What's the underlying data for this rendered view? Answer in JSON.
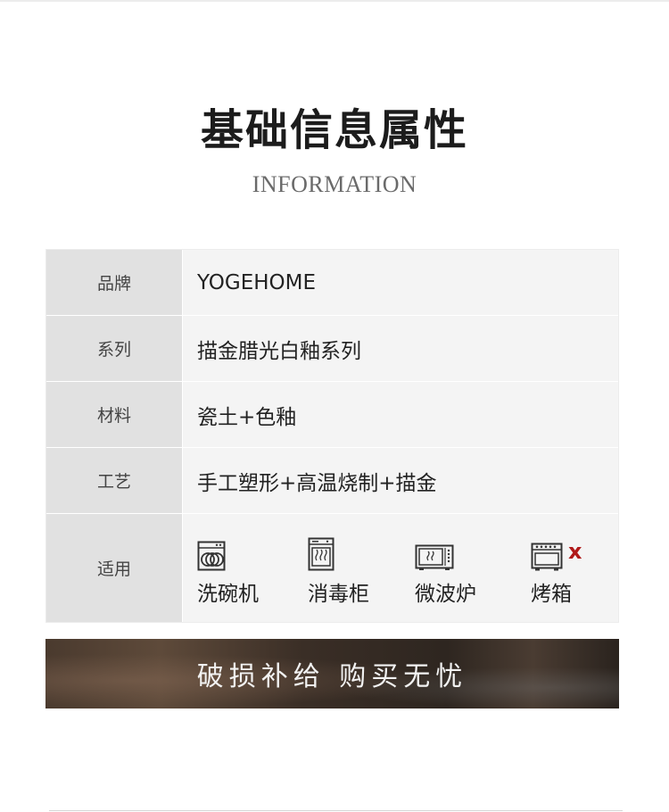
{
  "header": {
    "title": "基础信息属性",
    "subtitle": "INFORMATION"
  },
  "info_table": {
    "rows": [
      {
        "label": "品牌",
        "value": "YOGEHOME"
      },
      {
        "label": "系列",
        "value": "描金腊光白釉系列"
      },
      {
        "label": "材料",
        "value": "瓷土+色釉"
      },
      {
        "label": "工艺",
        "value": "手工塑形+高温烧制+描金"
      }
    ],
    "usage": {
      "label": "适用",
      "items": [
        {
          "label": "洗碗机",
          "icon": "dishwasher-icon",
          "allowed": true
        },
        {
          "label": "消毒柜",
          "icon": "sterilizer-icon",
          "allowed": true
        },
        {
          "label": "微波炉",
          "icon": "microwave-icon",
          "allowed": true
        },
        {
          "label": "烤箱",
          "icon": "oven-icon",
          "allowed": false,
          "mark": "x"
        }
      ]
    }
  },
  "banner": {
    "text": "破损补给  购买无忧"
  },
  "colors": {
    "label_bg": "#e1e1e1",
    "value_bg": "#f4f4f4",
    "not_allowed_mark": "#b01a1a"
  }
}
